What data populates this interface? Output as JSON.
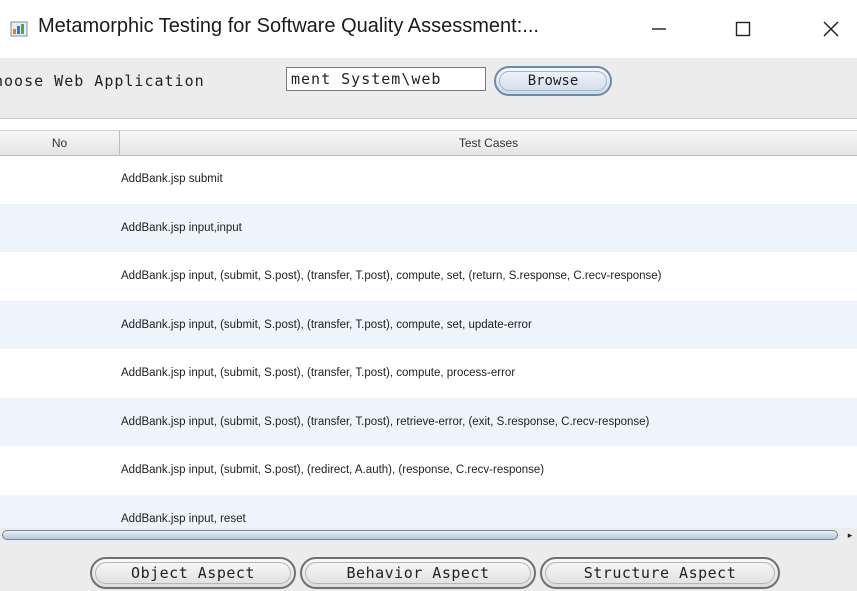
{
  "window": {
    "title": "Metamorphic Testing for Software Quality Assessment:...",
    "app_icon": "java-app-icon",
    "controls": {
      "minimize": "minimize-icon",
      "maximize": "maximize-icon",
      "close": "close-icon"
    }
  },
  "chooser": {
    "label": "hoose Web Application",
    "path_value": "ment System\\web",
    "browse_label": "Browse"
  },
  "table": {
    "columns": [
      "No",
      "Test Cases"
    ],
    "rows": [
      {
        "no": "",
        "case": "AddBank.jsp submit"
      },
      {
        "no": "",
        "case": "AddBank.jsp input,input"
      },
      {
        "no": "",
        "case": "AddBank.jsp input, (submit, S.post), (transfer, T.post), compute, set, (return, S.response, C.recv-response)"
      },
      {
        "no": "",
        "case": "AddBank.jsp input, (submit, S.post), (transfer, T.post), compute, set, update-error"
      },
      {
        "no": "",
        "case": "AddBank.jsp input, (submit, S.post), (transfer, T.post), compute, process-error"
      },
      {
        "no": "",
        "case": "AddBank.jsp input, (submit, S.post), (transfer, T.post), retrieve-error, (exit, S.response, C.recv-response)"
      },
      {
        "no": "",
        "case": "AddBank.jsp input, (submit, S.post), (redirect, A.auth), (response, C.recv-response)"
      },
      {
        "no": "",
        "case": "AddBank.jsp input, reset"
      }
    ]
  },
  "buttons": {
    "object": "Object Aspect",
    "behavior": "Behavior Aspect",
    "structure": "Structure Aspect"
  },
  "colors": {
    "row_alt": "#eef4fb",
    "button_border": "#707070",
    "browse_border": "#6d8aa8"
  }
}
